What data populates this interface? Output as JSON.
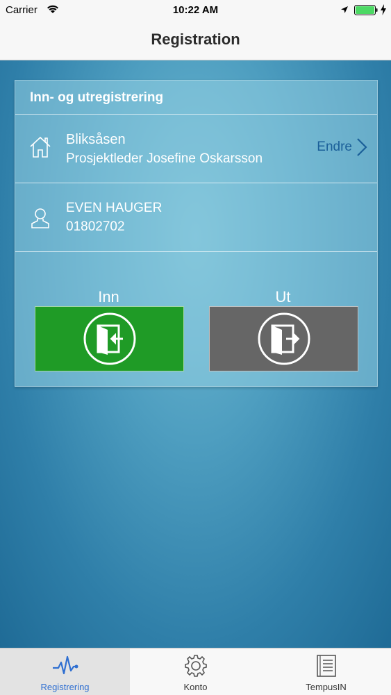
{
  "status_bar": {
    "carrier": "Carrier",
    "time": "10:22 AM"
  },
  "nav": {
    "title": "Registration"
  },
  "card": {
    "title": "Inn- og utregistrering",
    "location": {
      "name": "Bliksåsen",
      "manager": "Prosjektleder Josefine Oskarsson",
      "change_label": "Endre"
    },
    "user": {
      "name": "EVEN HAUGER",
      "id": "01802702"
    },
    "check_in": {
      "label": "Inn",
      "color": "#1f9b26"
    },
    "check_out": {
      "label": "Ut",
      "color": "#666666"
    }
  },
  "tabs": [
    {
      "label": "Registrering",
      "icon": "pulse-icon",
      "active": true
    },
    {
      "label": "Konto",
      "icon": "gear-icon",
      "active": false
    },
    {
      "label": "TempusIN",
      "icon": "document-icon",
      "active": false
    }
  ],
  "colors": {
    "accent": "#2f6fd1",
    "link": "#1a5f99"
  }
}
